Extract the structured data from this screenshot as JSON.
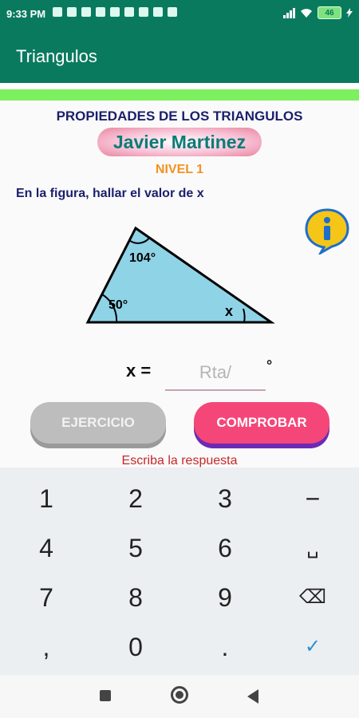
{
  "status_bar": {
    "time": "9:33 PM",
    "battery": "46"
  },
  "app_bar": {
    "title": "Triangulos"
  },
  "content": {
    "heading": "PROPIEDADES DE LOS TRIANGULOS",
    "author": "Javier Martinez",
    "level": "NIVEL 1",
    "question": "En la figura, hallar el valor de x",
    "info_icon": "info-icon",
    "figure": {
      "top_angle": "104°",
      "left_angle": "50°",
      "right_angle": "x",
      "fill_color": "#8fd3e6"
    },
    "answer": {
      "label": "x =",
      "placeholder": "Rta/",
      "value": "",
      "unit": "°"
    },
    "buttons": {
      "exercise": "EJERCICIO",
      "check": "COMPROBAR"
    },
    "message": "Escriba la respuesta"
  },
  "keyboard": {
    "rows": [
      [
        "1",
        "2",
        "3",
        "−"
      ],
      [
        "4",
        "5",
        "6",
        "␣"
      ],
      [
        "7",
        "8",
        "9",
        "⌫"
      ],
      [
        ",",
        "0",
        ".",
        "✓"
      ]
    ]
  },
  "colors": {
    "primary": "#0a7a5f",
    "accent_green": "#7cf05e",
    "check_button": "#f44679",
    "exercise_button": "#bdbdbd",
    "level_text": "#f39223",
    "heading_text": "#1b1f6b",
    "message_text": "#c62828"
  },
  "nav_bar": {
    "icons": [
      "recent-apps-icon",
      "home-icon",
      "back-icon"
    ]
  }
}
